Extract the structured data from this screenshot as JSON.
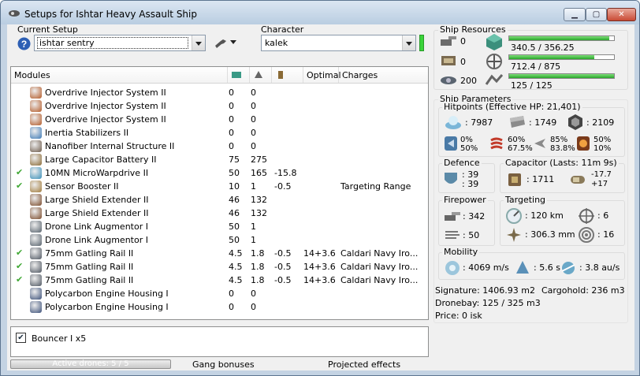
{
  "window": {
    "title": "Setups for Ishtar Heavy Assault Ship"
  },
  "setup": {
    "label": "Current Setup",
    "value": "ishtar sentry"
  },
  "character": {
    "label": "Character",
    "value": "kalek"
  },
  "modules": {
    "headers": {
      "name": "Modules",
      "optimal": "Optimal",
      "charges": "Charges"
    },
    "rows": [
      {
        "active": "",
        "name": "Overdrive Injector System II",
        "c1": "0",
        "c2": "0",
        "c3": "",
        "opt": "",
        "chg": "",
        "icon": "overdrive-icon",
        "color": "#b35a28"
      },
      {
        "active": "",
        "name": "Overdrive Injector System II",
        "c1": "0",
        "c2": "0",
        "c3": "",
        "opt": "",
        "chg": "",
        "icon": "overdrive-icon",
        "color": "#b35a28"
      },
      {
        "active": "",
        "name": "Overdrive Injector System II",
        "c1": "0",
        "c2": "0",
        "c3": "",
        "opt": "",
        "chg": "",
        "icon": "overdrive-icon",
        "color": "#b35a28"
      },
      {
        "active": "",
        "name": "Inertia Stabilizers II",
        "c1": "0",
        "c2": "0",
        "c3": "",
        "opt": "",
        "chg": "",
        "icon": "inertia-icon",
        "color": "#3d79b5"
      },
      {
        "active": "",
        "name": "Nanofiber Internal Structure II",
        "c1": "0",
        "c2": "0",
        "c3": "",
        "opt": "",
        "chg": "",
        "icon": "nanofiber-icon",
        "color": "#6c5a4a"
      },
      {
        "active": "",
        "name": "Large Capacitor Battery II",
        "c1": "75",
        "c2": "275",
        "c3": "",
        "opt": "",
        "chg": "",
        "icon": "battery-icon",
        "color": "#8a6a35"
      },
      {
        "active": "✔",
        "name": "10MN MicroWarpdrive II",
        "c1": "50",
        "c2": "165",
        "c3": "-15.8",
        "opt": "",
        "chg": "",
        "icon": "mwd-icon",
        "color": "#3a8fb8"
      },
      {
        "active": "✔",
        "name": "Sensor Booster II",
        "c1": "10",
        "c2": "1",
        "c3": "-0.5",
        "opt": "",
        "chg": "Targeting Range",
        "icon": "sensor-booster-icon",
        "color": "#a07a3a"
      },
      {
        "active": "",
        "name": "Large Shield Extender II",
        "c1": "46",
        "c2": "132",
        "c3": "",
        "opt": "",
        "chg": "",
        "icon": "shield-extender-icon",
        "color": "#7a4a2a"
      },
      {
        "active": "",
        "name": "Large Shield Extender II",
        "c1": "46",
        "c2": "132",
        "c3": "",
        "opt": "",
        "chg": "",
        "icon": "shield-extender-icon",
        "color": "#7a4a2a"
      },
      {
        "active": "",
        "name": "Drone Link Augmentor I",
        "c1": "50",
        "c2": "1",
        "c3": "",
        "opt": "",
        "chg": "",
        "icon": "drone-link-icon",
        "color": "#55606b"
      },
      {
        "active": "",
        "name": "Drone Link Augmentor I",
        "c1": "50",
        "c2": "1",
        "c3": "",
        "opt": "",
        "chg": "",
        "icon": "drone-link-icon",
        "color": "#55606b"
      },
      {
        "active": "✔",
        "name": "75mm Gatling Rail II",
        "c1": "4.5",
        "c2": "1.8",
        "c3": "-0.5",
        "opt": "14+3.6",
        "chg": "Caldari Navy Iro...",
        "icon": "railgun-icon",
        "color": "#4d5560"
      },
      {
        "active": "✔",
        "name": "75mm Gatling Rail II",
        "c1": "4.5",
        "c2": "1.8",
        "c3": "-0.5",
        "opt": "14+3.6",
        "chg": "Caldari Navy Iro...",
        "icon": "railgun-icon",
        "color": "#4d5560"
      },
      {
        "active": "✔",
        "name": "75mm Gatling Rail II",
        "c1": "4.5",
        "c2": "1.8",
        "c3": "-0.5",
        "opt": "14+3.6",
        "chg": "Caldari Navy Iro...",
        "icon": "railgun-icon",
        "color": "#4d5560"
      },
      {
        "active": "",
        "name": "Polycarbon Engine Housing I",
        "c1": "0",
        "c2": "0",
        "c3": "",
        "opt": "",
        "chg": "",
        "icon": "polycarbon-icon",
        "color": "#3a4f78"
      },
      {
        "active": "",
        "name": "Polycarbon Engine Housing I",
        "c1": "0",
        "c2": "0",
        "c3": "",
        "opt": "",
        "chg": "",
        "icon": "polycarbon-icon",
        "color": "#3a4f78"
      }
    ]
  },
  "drones": {
    "item": "Bouncer I x5"
  },
  "bottom": {
    "active_drones": "Active drones: 5 / 5",
    "gang": "Gang bonuses",
    "projected": "Projected effects"
  },
  "resources": {
    "title": "Ship Resources",
    "turrets": "0",
    "launchers": "0",
    "dronebw": "200",
    "cpu": {
      "text": "340.5 / 356.25",
      "fraction": 0.956
    },
    "power": {
      "text": "712.4 / 875",
      "fraction": 0.814
    },
    "calibration": {
      "text": "125 / 125",
      "fraction": 1.0
    }
  },
  "params": {
    "title": "Ship Parameters",
    "hp": {
      "title": "Hitpoints (Effective HP: 21,401)",
      "shield": ": 7987",
      "armor": ": 1749",
      "structure": ": 2109",
      "em": "0%",
      "em2": "50%",
      "thermal": "60%",
      "thermal2": "67.5%",
      "kinetic": "85%",
      "kinetic2": "83.8%",
      "explosive": "50%",
      "explosive2": "10%"
    },
    "defence": {
      "title": "Defence",
      "l1": ": 39",
      "l2": ": 39"
    },
    "capacitor": {
      "title": "Capacitor (Lasts: 11m 9s)",
      "cap": ": 1711",
      "rate1": "-17.7",
      "rate2": "+17"
    },
    "firepower": {
      "title": "Firepower",
      "dps": ": 342",
      "volley": ": 50"
    },
    "targeting": {
      "title": "Targeting",
      "range": ": 120 km",
      "targets": ": 6",
      "res": ": 306.3 mm",
      "sig": ": 16"
    },
    "mobility": {
      "title": "Mobility",
      "speed": ": 4069 m/s",
      "align": ": 5.6 s",
      "warp": ": 3.8 au/s"
    },
    "signature": "Signature: 1406.93 m2",
    "cargohold": "Cargohold: 236 m3",
    "dronebay": "Dronebay: 125 / 325 m3",
    "price": "Price: 0 isk"
  }
}
